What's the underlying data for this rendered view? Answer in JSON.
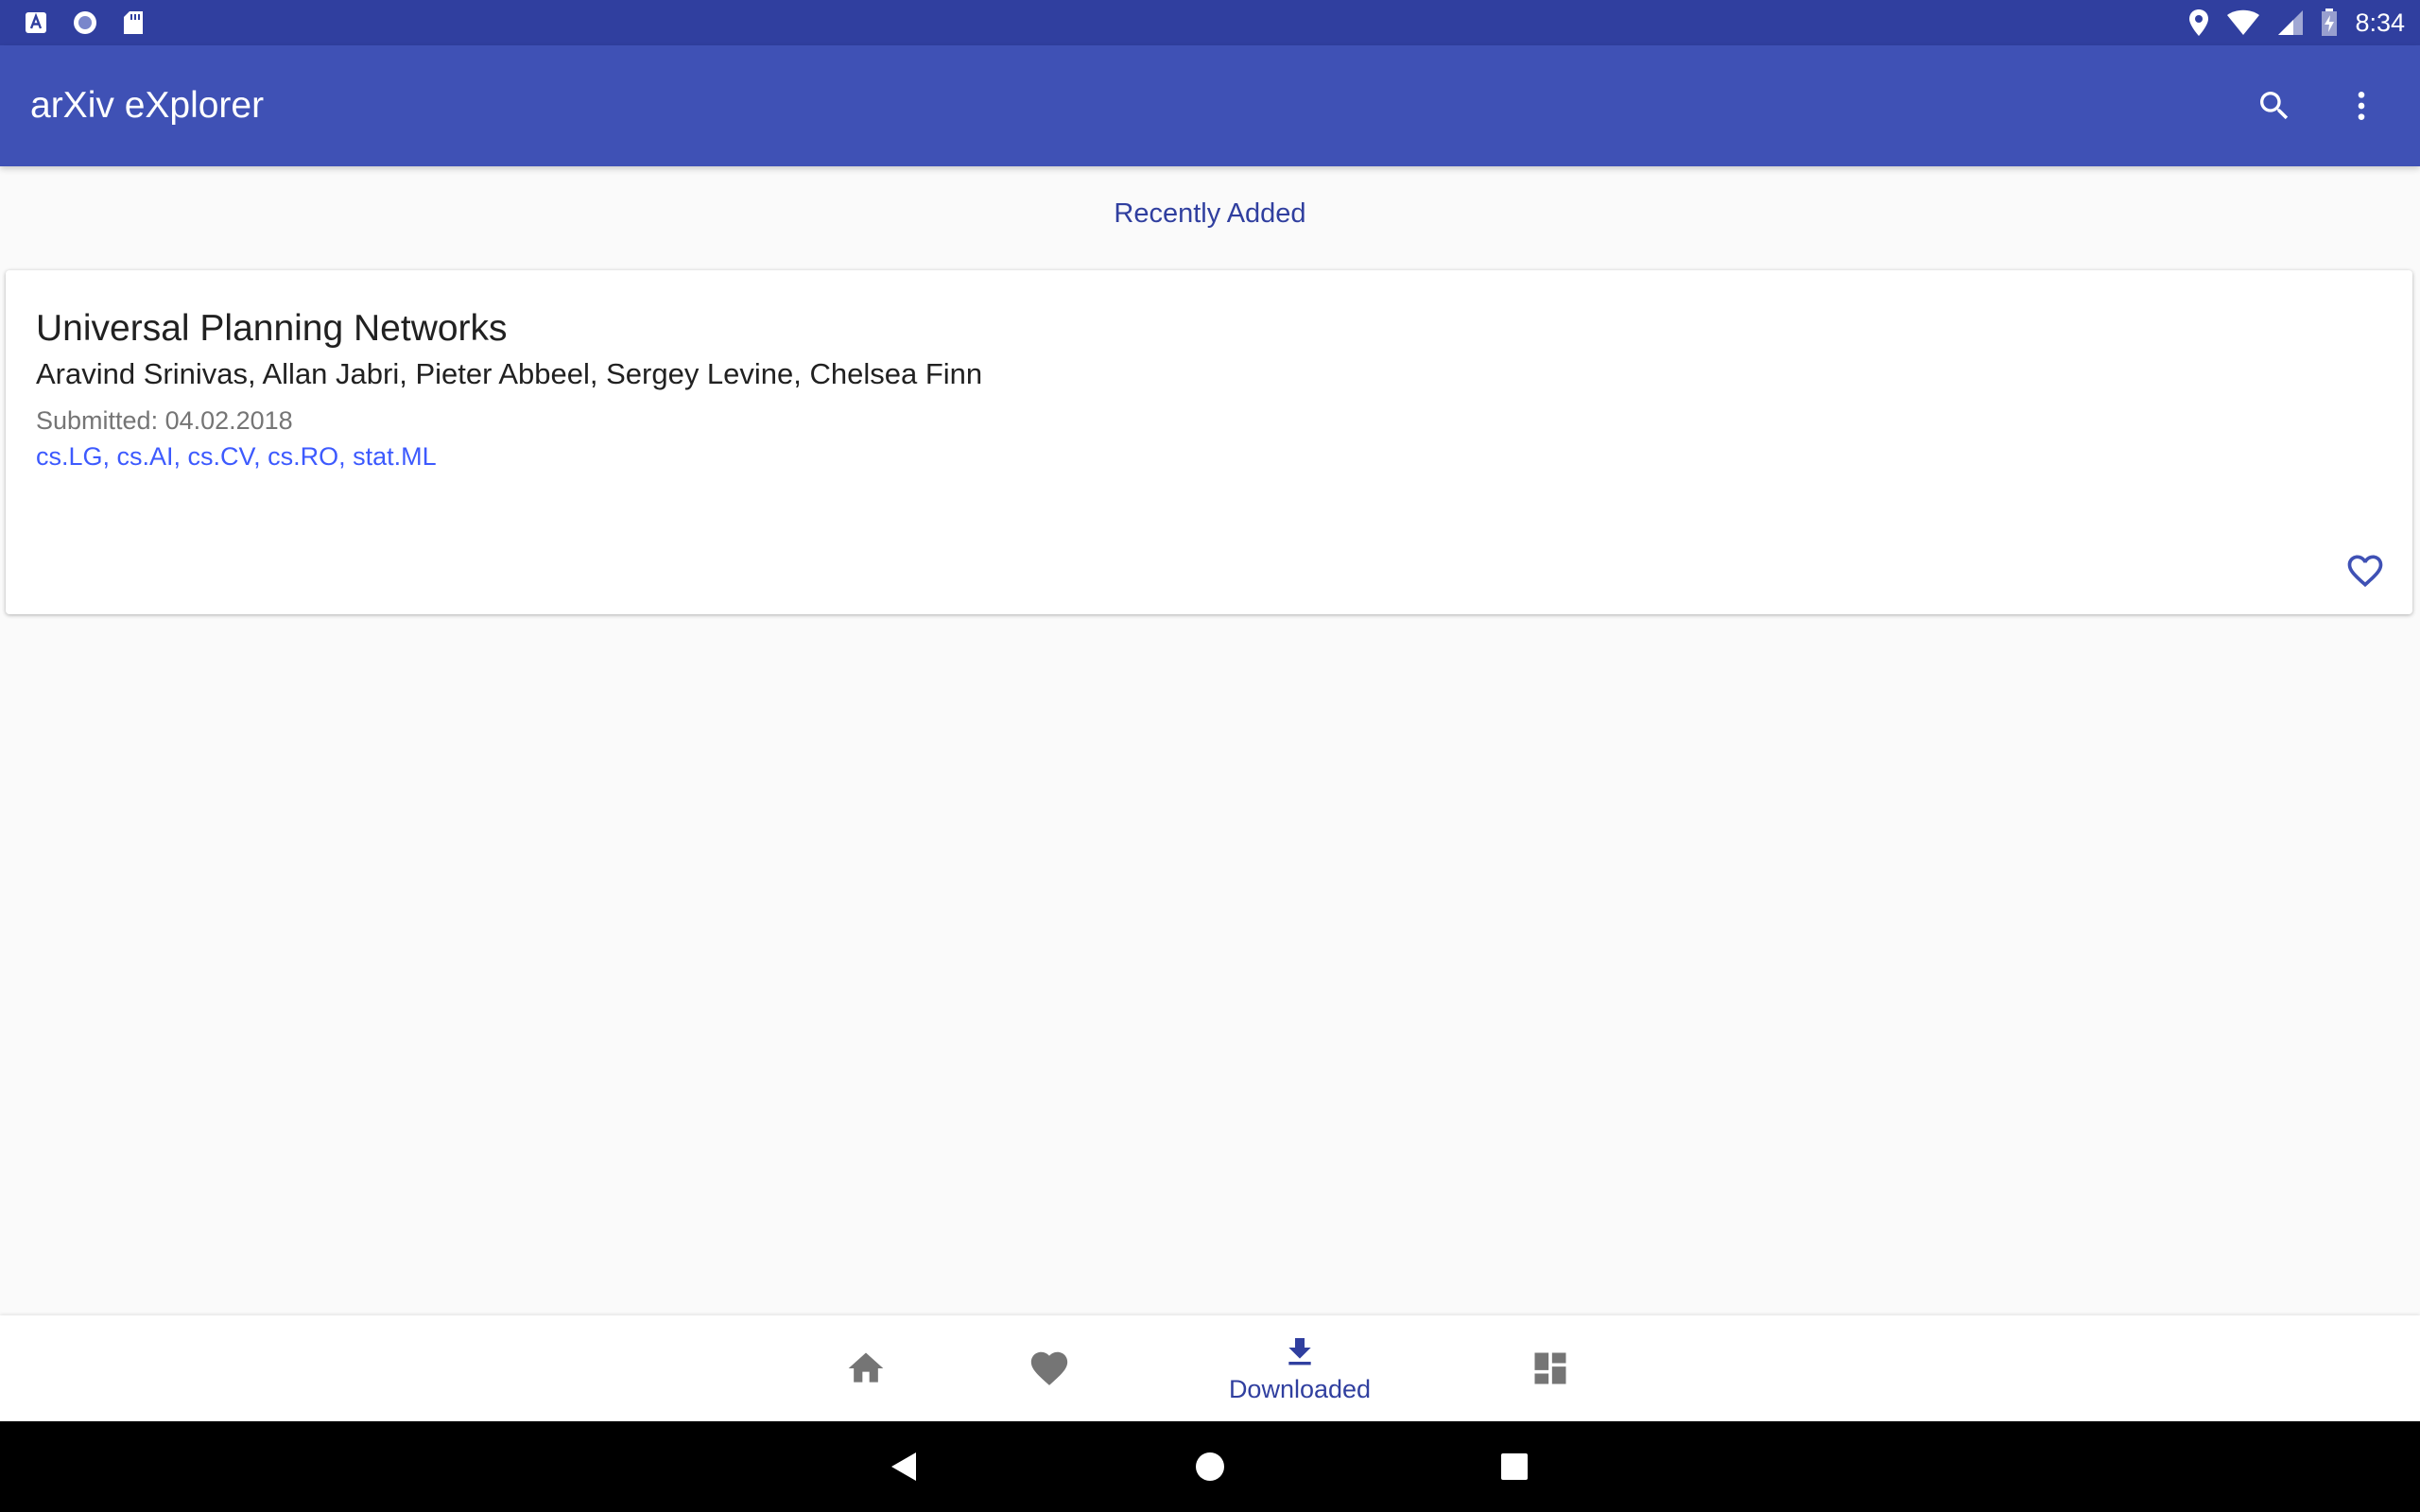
{
  "status_bar": {
    "time": "8:34",
    "left_icons": [
      "text-a-icon",
      "circle-app-icon",
      "sd-card-icon"
    ],
    "right_icons": [
      "location-icon",
      "wifi-icon",
      "signal-icon",
      "battery-charging-icon"
    ]
  },
  "app_bar": {
    "title": "arXiv eXplorer",
    "actions": [
      "search-icon",
      "more-vert-icon"
    ]
  },
  "section": {
    "title": "Recently Added"
  },
  "papers": [
    {
      "title": "Universal Planning Networks",
      "authors": "Aravind Srinivas, Allan Jabri, Pieter Abbeel, Sergey Levine, Chelsea Finn",
      "submitted": "Submitted: 04.02.2018",
      "categories": "cs.LG, cs.AI, cs.CV, cs.RO, stat.ML",
      "favorite_icon": "heart-outline-icon"
    }
  ],
  "bottom_nav": {
    "items": [
      {
        "icon": "home-icon",
        "label": ""
      },
      {
        "icon": "heart-icon",
        "label": ""
      },
      {
        "icon": "download-icon",
        "label": "Downloaded",
        "active": true
      },
      {
        "icon": "dashboard-icon",
        "label": ""
      }
    ]
  },
  "system_nav": [
    "back-icon",
    "home-circle-icon",
    "recents-icon"
  ],
  "colors": {
    "primary": "#3f51b5",
    "primary_dark": "#303f9f",
    "accent": "#3d5afe",
    "background": "#fafafa"
  }
}
